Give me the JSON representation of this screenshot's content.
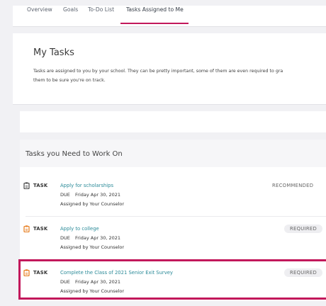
{
  "tabs": [
    {
      "label": "Overview"
    },
    {
      "label": "Goals"
    },
    {
      "label": "To-Do List"
    },
    {
      "label": "Tasks Assigned to Me",
      "active": true
    }
  ],
  "page": {
    "title": "My Tasks",
    "description_line1": "Tasks are assigned to you by your school. They can be pretty important, some of them are even required to gra",
    "description_line2": "them to be sure you're on track."
  },
  "section": {
    "title": "Tasks you Need to Work On"
  },
  "tasks": [
    {
      "type": "TASK",
      "title": "Apply for scholarships",
      "due_label": "DUE",
      "due_date": "Friday Apr 30, 2021",
      "assigned": "Assigned by Your Counselor",
      "status": "RECOMMENDED",
      "icon": "clipboard-icon",
      "icon_color": "#555555"
    },
    {
      "type": "TASK",
      "title": "Apply to college",
      "due_label": "DUE",
      "due_date": "Friday Apr 30, 2021",
      "assigned": "Assigned by Your Counselor",
      "status": "REQUIRED",
      "icon": "clipboard-icon",
      "icon_color": "#e8842a"
    },
    {
      "type": "TASK",
      "title": "Complete the Class of 2021 Senior Exit Survey",
      "due_label": "DUE",
      "due_date": "Friday Apr 30, 2021",
      "assigned": "Assigned by Your Counselor",
      "status": "REQUIRED",
      "icon": "clipboard-icon",
      "icon_color": "#e8842a"
    }
  ],
  "colors": {
    "accent": "#c2185b",
    "link": "#2a8a98",
    "warning": "#e8842a"
  }
}
